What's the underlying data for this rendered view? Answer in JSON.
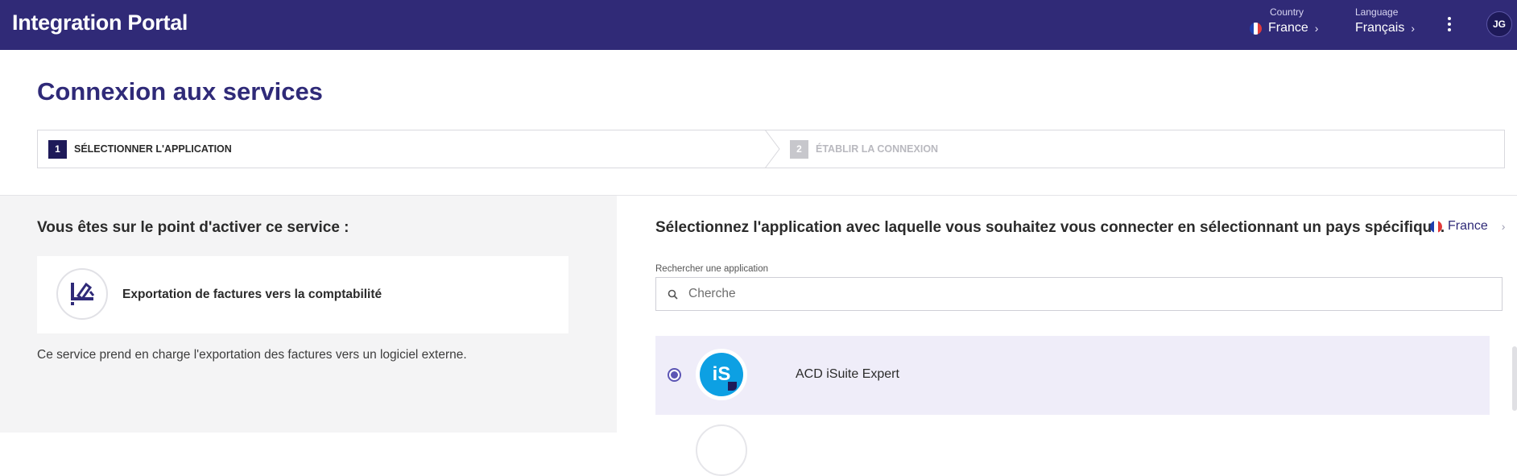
{
  "header": {
    "brand": "Integration Portal",
    "country": {
      "label": "Country",
      "value": "France"
    },
    "language": {
      "label": "Language",
      "value": "Français"
    },
    "avatar_initials": "JG",
    "background": "#302a77"
  },
  "page": {
    "title": "Connexion aux services"
  },
  "stepper": {
    "steps": [
      {
        "number": "1",
        "label": "SÉLECTIONNER L'APPLICATION",
        "active": true
      },
      {
        "number": "2",
        "label": "ÉTABLIR LA CONNEXION",
        "active": false
      }
    ]
  },
  "left": {
    "heading": "Vous êtes sur le point d'activer ce service :",
    "service_name": "Exportation de factures vers la comptabilité",
    "service_description": "Ce service prend en charge l'exportation des factures vers un logiciel externe."
  },
  "right": {
    "heading": "Sélectionnez l'application avec laquelle vous souhaitez vous connecter en sélectionnant un pays spécifique.",
    "country": "France",
    "search_label": "Rechercher une application",
    "search_placeholder": "Cherche",
    "apps": [
      {
        "name": "ACD iSuite Expert",
        "logo_text": "iS",
        "selected": true,
        "logo_color": "#0da0e3"
      }
    ]
  },
  "colors": {
    "accent": "#302a77",
    "selected_row": "#efedf9",
    "radio": "#5c55b4"
  }
}
